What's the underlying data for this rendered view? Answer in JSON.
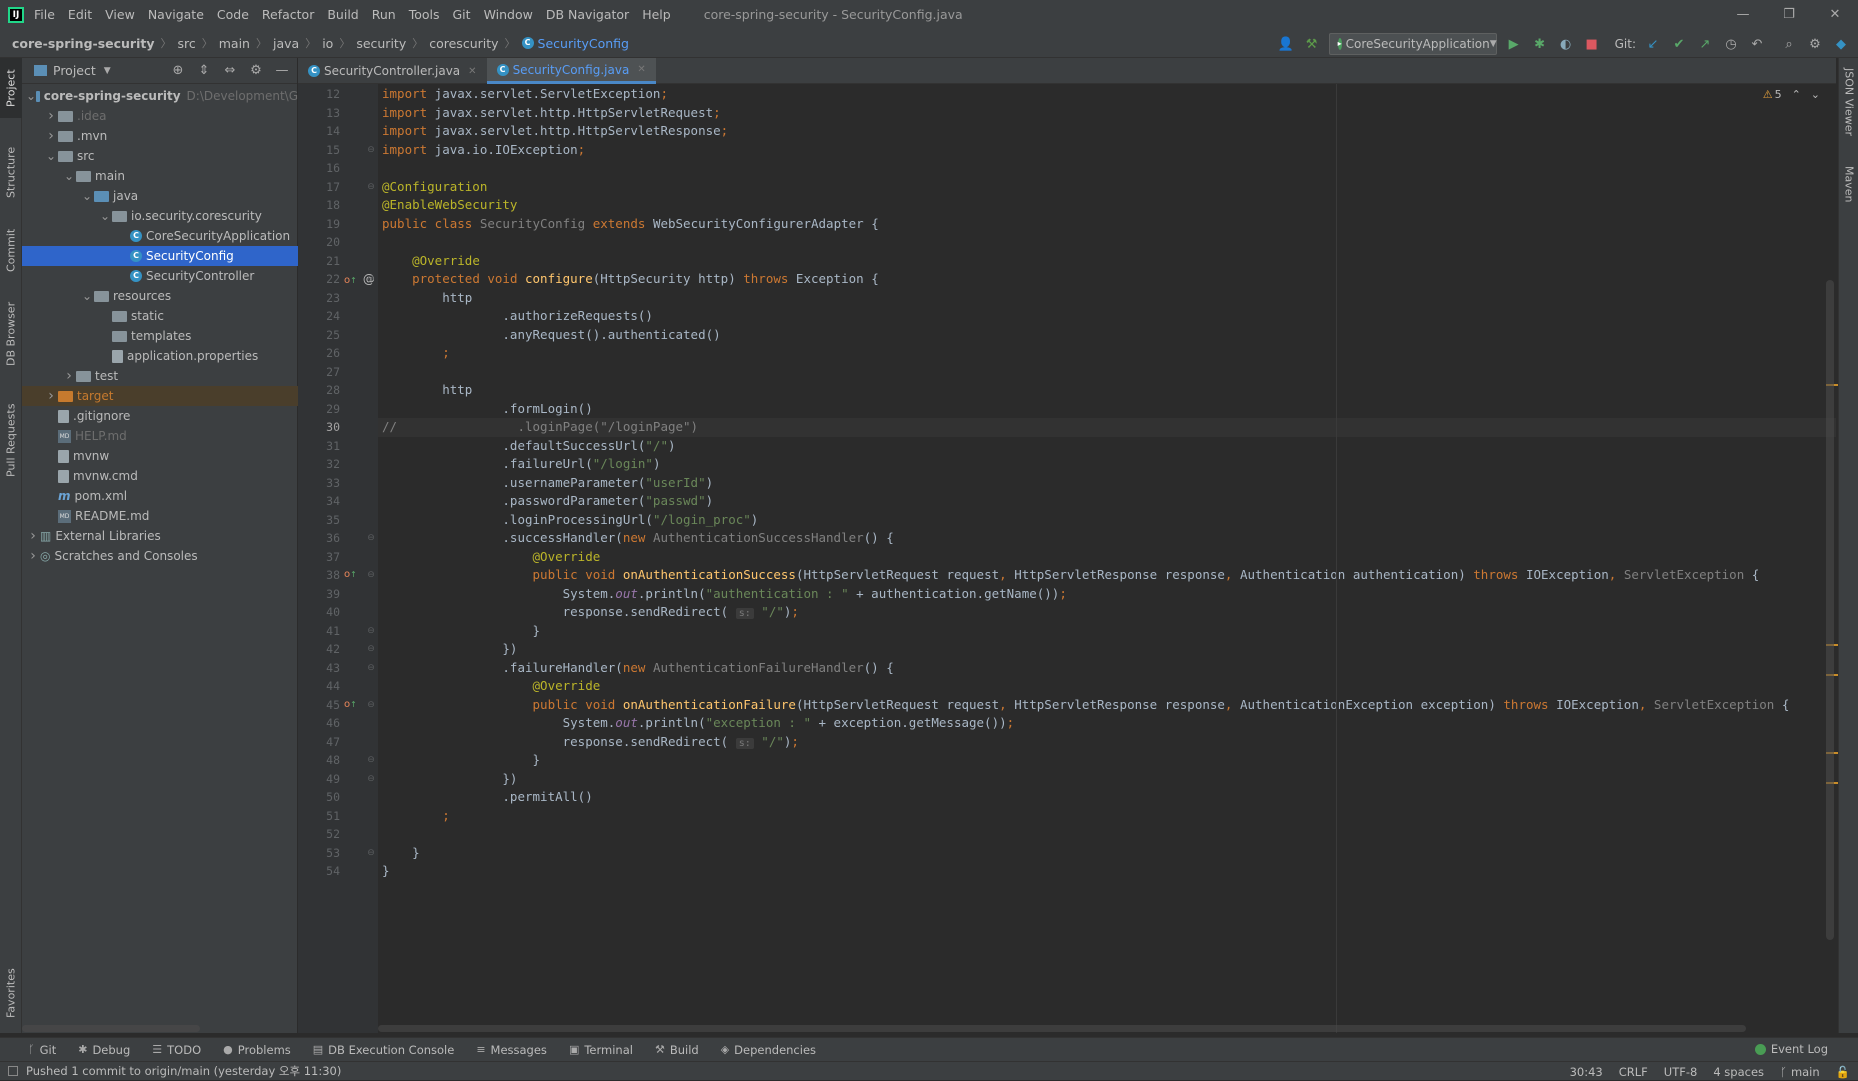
{
  "menu": [
    "File",
    "Edit",
    "View",
    "Navigate",
    "Code",
    "Refactor",
    "Build",
    "Run",
    "Tools",
    "Git",
    "Window",
    "DB Navigator",
    "Help"
  ],
  "window_title": "core-spring-security - SecurityConfig.java",
  "window_controls": {
    "minimize": "—",
    "restore": "❐",
    "close": "✕"
  },
  "breadcrumb": [
    "core-spring-security",
    "src",
    "main",
    "java",
    "io",
    "security",
    "corescurity",
    "SecurityConfig"
  ],
  "run_config": "CoreSecurityApplication",
  "git_label": "Git:",
  "project_panel": {
    "title": "Project",
    "tree": [
      {
        "depth": 0,
        "arrow": "open",
        "icon": "module-folder",
        "label": "core-spring-security",
        "suffix": "D:\\Development\\G",
        "bold": true
      },
      {
        "depth": 1,
        "arrow": "closed",
        "icon": "folder",
        "label": ".idea",
        "dim": true
      },
      {
        "depth": 1,
        "arrow": "closed",
        "icon": "folder",
        "label": ".mvn"
      },
      {
        "depth": 1,
        "arrow": "open",
        "icon": "folder",
        "label": "src"
      },
      {
        "depth": 2,
        "arrow": "open",
        "icon": "folder",
        "label": "main"
      },
      {
        "depth": 3,
        "arrow": "open",
        "icon": "folder-blue",
        "label": "java"
      },
      {
        "depth": 4,
        "arrow": "open",
        "icon": "package",
        "label": "io.security.corescurity"
      },
      {
        "depth": 5,
        "arrow": "none",
        "icon": "class",
        "label": "CoreSecurityApplication"
      },
      {
        "depth": 5,
        "arrow": "none",
        "icon": "class",
        "label": "SecurityConfig",
        "selected": true
      },
      {
        "depth": 5,
        "arrow": "none",
        "icon": "class",
        "label": "SecurityController"
      },
      {
        "depth": 3,
        "arrow": "open",
        "icon": "folder",
        "label": "resources"
      },
      {
        "depth": 4,
        "arrow": "none",
        "icon": "folder",
        "label": "static"
      },
      {
        "depth": 4,
        "arrow": "none",
        "icon": "folder",
        "label": "templates"
      },
      {
        "depth": 4,
        "arrow": "none",
        "icon": "properties",
        "label": "application.properties"
      },
      {
        "depth": 2,
        "arrow": "closed",
        "icon": "folder",
        "label": "test"
      },
      {
        "depth": 1,
        "arrow": "closed",
        "icon": "folder-orange",
        "label": "target",
        "target": true
      },
      {
        "depth": 1,
        "arrow": "none",
        "icon": "file",
        "label": ".gitignore"
      },
      {
        "depth": 1,
        "arrow": "none",
        "icon": "md",
        "label": "HELP.md",
        "dim": true
      },
      {
        "depth": 1,
        "arrow": "none",
        "icon": "file",
        "label": "mvnw"
      },
      {
        "depth": 1,
        "arrow": "none",
        "icon": "file",
        "label": "mvnw.cmd"
      },
      {
        "depth": 1,
        "arrow": "none",
        "icon": "maven",
        "label": "pom.xml"
      },
      {
        "depth": 1,
        "arrow": "none",
        "icon": "md",
        "label": "README.md"
      },
      {
        "depth": 0,
        "arrow": "closed",
        "icon": "libraries",
        "label": "External Libraries"
      },
      {
        "depth": 0,
        "arrow": "closed",
        "icon": "scratches",
        "label": "Scratches and Consoles"
      }
    ]
  },
  "left_tool_tabs": [
    "Project",
    "Structure",
    "Commit",
    "DB Browser",
    "Pull Requests",
    "Favorites"
  ],
  "right_tool_tabs": [
    "JSON Viewer",
    "Maven"
  ],
  "editor_tabs": [
    {
      "label": "SecurityController.java",
      "active": false
    },
    {
      "label": "SecurityConfig.java",
      "active": true
    }
  ],
  "inspection": {
    "warnings": "5",
    "up": "⌃",
    "down": "⌄"
  },
  "code_lines": [
    {
      "n": "12",
      "html": "<span class='kw'>import</span> javax.servlet.ServletException<span class='kw'>;</span>"
    },
    {
      "n": "13",
      "html": "<span class='kw'>import</span> javax.servlet.http.HttpServletRequest<span class='kw'>;</span>"
    },
    {
      "n": "14",
      "html": "<span class='kw'>import</span> javax.servlet.http.HttpServletResponse<span class='kw'>;</span>"
    },
    {
      "n": "15",
      "html": "<span class='kw'>import</span> java.io.IOException<span class='kw'>;</span>",
      "fold": "⊖"
    },
    {
      "n": "16",
      "html": ""
    },
    {
      "n": "17",
      "html": "<span class='an'>@Configuration</span>",
      "fold": "⊖"
    },
    {
      "n": "18",
      "html": "<span class='an'>@EnableWebSecurity</span>"
    },
    {
      "n": "19",
      "html": "<span class='kw'>public class</span> <span class='gr'>SecurityConfig</span> <span class='kw'>extends</span> WebSecurityConfigurerAdapter {"
    },
    {
      "n": "20",
      "html": ""
    },
    {
      "n": "21",
      "html": "    <span class='an'>@Override</span>"
    },
    {
      "n": "22",
      "html": "    <span class='kw'>protected void</span> <span class='fn'>configure</span>(HttpSecurity http) <span class='kw'>throws</span> Exception {",
      "icons": "o↑ @",
      "fold": "⊖"
    },
    {
      "n": "23",
      "html": "        http"
    },
    {
      "n": "24",
      "html": "                .authorizeRequests()"
    },
    {
      "n": "25",
      "html": "                .anyRequest().authenticated()"
    },
    {
      "n": "26",
      "html": "        <span class='kw'>;</span>"
    },
    {
      "n": "27",
      "html": ""
    },
    {
      "n": "28",
      "html": "        http"
    },
    {
      "n": "29",
      "html": "                .formLogin()"
    },
    {
      "n": "30",
      "html": "<span class='cm'>//                .loginPage(\"/loginPage\")</span>",
      "current": true
    },
    {
      "n": "31",
      "html": "                .defaultSuccessUrl(<span class='st'>\"/\"</span>)"
    },
    {
      "n": "32",
      "html": "                .failureUrl(<span class='st'>\"/login\"</span>)"
    },
    {
      "n": "33",
      "html": "                .usernameParameter(<span class='st'>\"userId\"</span>)"
    },
    {
      "n": "34",
      "html": "                .passwordParameter(<span class='st'>\"passwd\"</span>)"
    },
    {
      "n": "35",
      "html": "                .loginProcessingUrl(<span class='st'>\"/login_proc\"</span>)"
    },
    {
      "n": "36",
      "html": "                .successHandler(<span class='kw'>new</span> <span class='gr'>AuthenticationSuccessHandler</span>() {",
      "fold": "⊖"
    },
    {
      "n": "37",
      "html": "                    <span class='an'>@Override</span>"
    },
    {
      "n": "38",
      "html": "                    <span class='kw'>public void</span> <span class='fn'>onAuthenticationSuccess</span>(HttpServletRequest request<span class='kw'>,</span> HttpServletResponse response<span class='kw'>,</span> Authentication authentication) <span class='kw'>throws</span> IOException<span class='kw'>,</span> <span class='gr'>ServletException</span> {",
      "icons": "o↑",
      "fold": "⊖"
    },
    {
      "n": "39",
      "html": "                        System.<span class='it'>out</span>.println(<span class='st'>\"authentication : \"</span> + authentication.getName())<span class='kw'>;</span>"
    },
    {
      "n": "40",
      "html": "                        response.sendRedirect( <span class='hint'>s:</span> <span class='st'>\"/\"</span>)<span class='kw'>;</span>"
    },
    {
      "n": "41",
      "html": "                    }",
      "fold": "⊖"
    },
    {
      "n": "42",
      "html": "                })",
      "fold": "⊖"
    },
    {
      "n": "43",
      "html": "                .failureHandler(<span class='kw'>new</span> <span class='gr'>AuthenticationFailureHandler</span>() {",
      "fold": "⊖"
    },
    {
      "n": "44",
      "html": "                    <span class='an'>@Override</span>"
    },
    {
      "n": "45",
      "html": "                    <span class='kw'>public void</span> <span class='fn'>onAuthenticationFailure</span>(HttpServletRequest request<span class='kw'>,</span> HttpServletResponse response<span class='kw'>,</span> AuthenticationException exception) <span class='kw'>throws</span> IOException<span class='kw'>,</span> <span class='gr'>ServletException</span> {",
      "icons": "o↑",
      "fold": "⊖"
    },
    {
      "n": "46",
      "html": "                        System.<span class='it'>out</span>.println(<span class='st'>\"exception : \"</span> + exception.getMessage())<span class='kw'>;</span>"
    },
    {
      "n": "47",
      "html": "                        response.sendRedirect( <span class='hint'>s:</span> <span class='st'>\"/\"</span>)<span class='kw'>;</span>"
    },
    {
      "n": "48",
      "html": "                    }",
      "fold": "⊖"
    },
    {
      "n": "49",
      "html": "                })",
      "fold": "⊖"
    },
    {
      "n": "50",
      "html": "                .permitAll()"
    },
    {
      "n": "51",
      "html": "        <span class='kw'>;</span>"
    },
    {
      "n": "52",
      "html": ""
    },
    {
      "n": "53",
      "html": "    }",
      "fold": "⊖"
    },
    {
      "n": "54",
      "html": "}"
    }
  ],
  "bottom_tools": [
    {
      "icon": "ᚴ",
      "label": "Git"
    },
    {
      "icon": "✱",
      "label": "Debug"
    },
    {
      "icon": "☰",
      "label": "TODO"
    },
    {
      "icon": "●",
      "label": "Problems"
    },
    {
      "icon": "▤",
      "label": "DB Execution Console"
    },
    {
      "icon": "≡",
      "label": "Messages"
    },
    {
      "icon": "▣",
      "label": "Terminal"
    },
    {
      "icon": "⚒",
      "label": "Build"
    },
    {
      "icon": "◈",
      "label": "Dependencies"
    }
  ],
  "event_log": "Event Log",
  "status": {
    "message": "Pushed 1 commit to origin/main (yesterday 오후 11:30)",
    "position": "30:43",
    "line_sep": "CRLF",
    "encoding": "UTF-8",
    "indent": "4 spaces",
    "branch": "main"
  },
  "colors": {
    "accent": "#589df6",
    "selection": "#2f65ca",
    "warning": "#c78c2a",
    "run_green": "#499c54"
  }
}
